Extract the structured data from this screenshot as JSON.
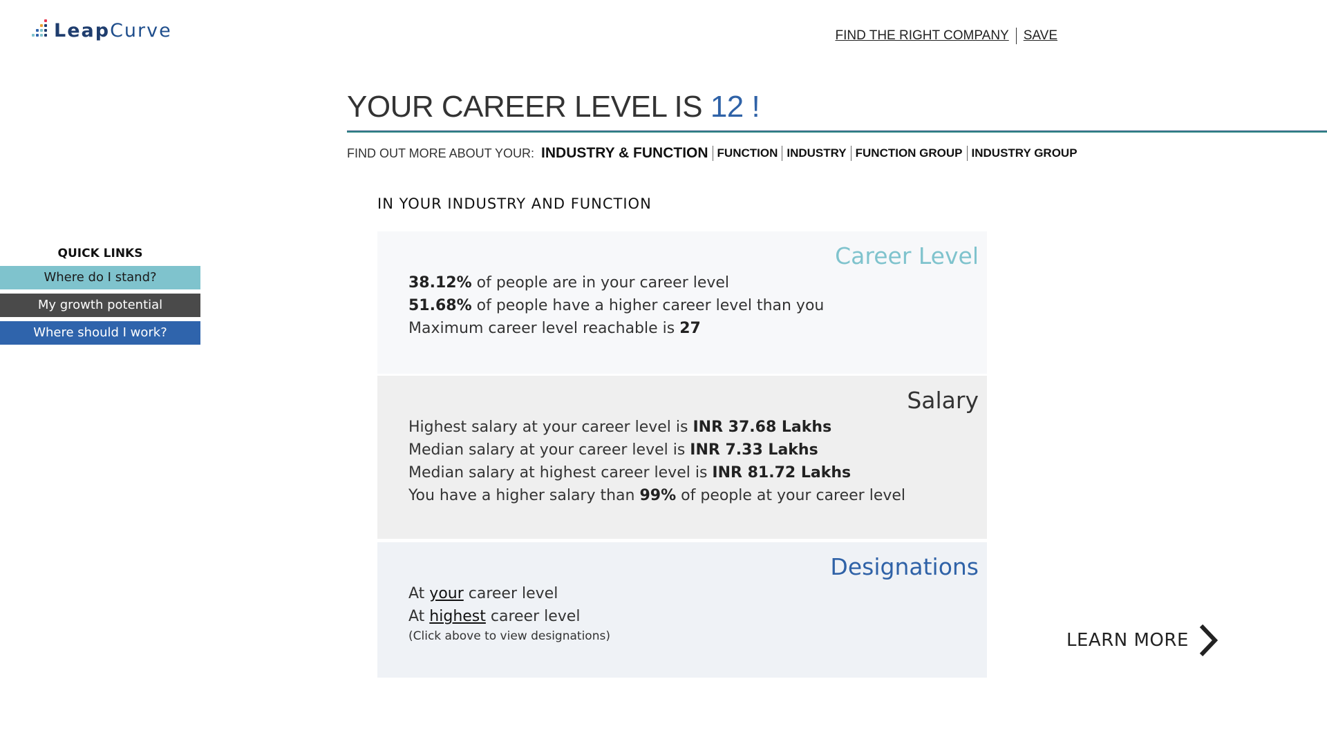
{
  "header": {
    "logo_bold": "Leap",
    "logo_light": "Curve",
    "links": [
      "FIND THE RIGHT COMPANY",
      "SAVE"
    ]
  },
  "title": {
    "prefix": "YOUR CAREER LEVEL IS ",
    "level": "12 !"
  },
  "findout": {
    "intro": "FIND OUT MORE ABOUT YOUR:",
    "tabs": [
      "INDUSTRY & FUNCTION",
      "FUNCTION",
      "INDUSTRY",
      "FUNCTION GROUP",
      "INDUSTRY GROUP"
    ],
    "active_tab": "INDUSTRY & FUNCTION"
  },
  "section_heading": "IN YOUR INDUSTRY AND FUNCTION",
  "quick_links": {
    "title": "QUICK LINKS",
    "items": [
      "Where do I stand?",
      "My growth potential",
      "Where should I work?"
    ]
  },
  "career_card": {
    "title": "Career Level",
    "line1_value": "38.12%",
    "line1_text": " of people are in your career level",
    "line2_value": "51.68%",
    "line2_text": " of people have a higher career level than you",
    "line3_text": "Maximum career level reachable is ",
    "line3_value": "27"
  },
  "salary_card": {
    "title": "Salary",
    "line1_text": "Highest salary at your career level is ",
    "line1_value": "INR 37.68 Lakhs",
    "line2_text": "Median salary at your career level is ",
    "line2_value": "INR 7.33 Lakhs",
    "line3_text": "Median salary at highest career level is ",
    "line3_value": "INR 81.72 Lakhs",
    "line4_text_a": "You have a higher salary than ",
    "line4_value": "99%",
    "line4_text_b": " of people at your career level"
  },
  "designations_card": {
    "title": "Designations",
    "line1_a": "At ",
    "line1_link": "your",
    "line1_b": " career level",
    "line2_a": "At ",
    "line2_link": "highest",
    "line2_b": " career level",
    "hint": "(Click above to view designations)"
  },
  "learn_more": "LEARN MORE",
  "colors": {
    "teal": "#7fc3cd",
    "dark_gray": "#4a4a4a",
    "blue": "#2f64ac"
  },
  "icons": [
    "logo-dots-icon",
    "chevron-right-icon"
  ]
}
